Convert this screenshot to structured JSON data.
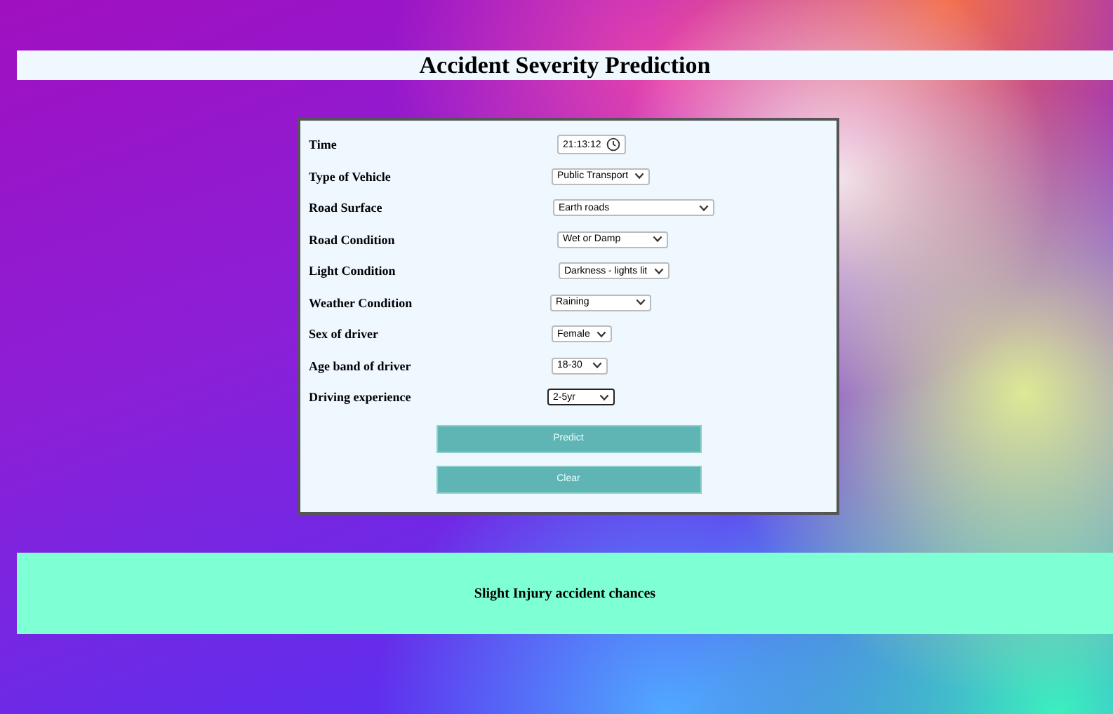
{
  "title": "Accident Severity Prediction",
  "fields": [
    {
      "label": "Time",
      "kind": "time",
      "value": "21:13:12",
      "focused": false
    },
    {
      "label": "Type of Vehicle",
      "kind": "select",
      "value": "Public Transport",
      "focused": false
    },
    {
      "label": "Road Surface",
      "kind": "select",
      "value": "Earth roads",
      "focused": false
    },
    {
      "label": "Road Condition",
      "kind": "select",
      "value": "Wet or Damp",
      "focused": false
    },
    {
      "label": "Light Condition",
      "kind": "select",
      "value": "Darkness - lights lit",
      "focused": false
    },
    {
      "label": "Weather Condition",
      "kind": "select",
      "value": "Raining",
      "focused": false
    },
    {
      "label": "Sex of driver",
      "kind": "select",
      "value": "Female",
      "focused": false
    },
    {
      "label": "Age band of driver",
      "kind": "select",
      "value": "18-30",
      "focused": false
    },
    {
      "label": "Driving experience",
      "kind": "select",
      "value": "2-5yr",
      "focused": true
    }
  ],
  "buttons": [
    "Predict",
    "Clear"
  ],
  "result": "Slight Injury accident chances"
}
